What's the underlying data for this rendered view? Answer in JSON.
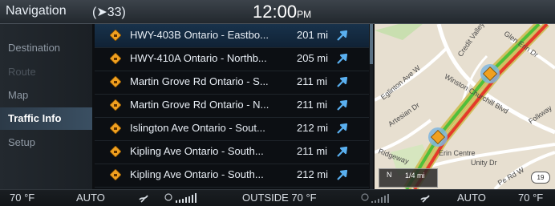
{
  "header": {
    "title": "Navigation",
    "signal": "(➤33)",
    "time": "12:00",
    "ampm": "PM"
  },
  "menu": [
    {
      "label": "Destination",
      "state": "normal"
    },
    {
      "label": "Route",
      "state": "disabled"
    },
    {
      "label": "Map",
      "state": "normal"
    },
    {
      "label": "Traffic Info",
      "state": "active"
    },
    {
      "label": "Setup",
      "state": "normal"
    }
  ],
  "traffic": [
    {
      "name": "HWY-403B Ontario - Eastbo...",
      "dist": "201 mi",
      "icon": "traffic-warning-icon"
    },
    {
      "name": "HWY-410A Ontario - Northb...",
      "dist": "205 mi",
      "icon": "traffic-warning-icon"
    },
    {
      "name": "Martin Grove Rd Ontario - S...",
      "dist": "211 mi",
      "icon": "traffic-warning-icon"
    },
    {
      "name": "Martin Grove Rd Ontario - N...",
      "dist": "211 mi",
      "icon": "traffic-warning-icon"
    },
    {
      "name": "Islington Ave Ontario - Sout...",
      "dist": "212 mi",
      "icon": "traffic-warning-icon"
    },
    {
      "name": "Kipling Ave Ontario - South...",
      "dist": "211 mi",
      "icon": "traffic-warning-icon"
    },
    {
      "name": "Kipling Ave Ontario - South...",
      "dist": "212 mi",
      "icon": "traffic-warning-icon"
    }
  ],
  "map": {
    "streets": [
      "Credit Valley",
      "Glen Erin Dr",
      "Eglinton Ave W",
      "Winston Churchill Blvd",
      "Artesian Dr",
      "Folkway",
      "Unity Dr",
      "Ridgeway",
      "Erin Centre",
      "Pe Rd W"
    ],
    "scale": "1/4 mi",
    "north": "N",
    "shield": "19"
  },
  "climate": {
    "left_temp": "70 °F",
    "left_mode": "AUTO",
    "outside": "OUTSIDE 70 °F",
    "right_mode": "AUTO",
    "right_temp": "70 °F"
  },
  "colors": {
    "accent": "#3a4f62",
    "warning": "#f0a020",
    "jam": "#e43a2a",
    "flow": "#4fbf3a"
  }
}
